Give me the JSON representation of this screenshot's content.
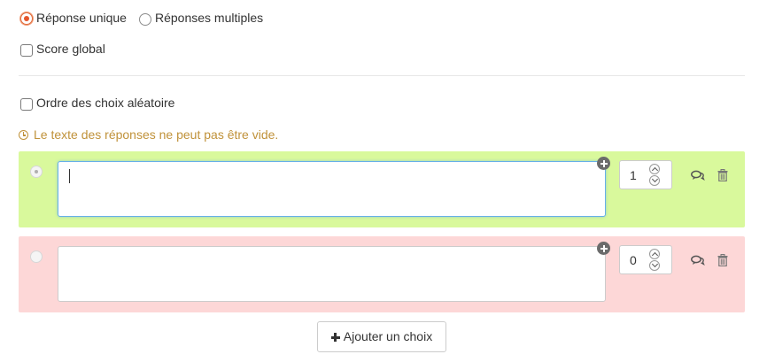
{
  "mode": {
    "single_label": "Réponse unique",
    "multiple_label": "Réponses multiples",
    "selected": "single"
  },
  "global_score": {
    "label": "Score global",
    "checked": false
  },
  "random_order": {
    "label": "Ordre des choix aléatoire",
    "checked": false
  },
  "warning": {
    "text": "Le texte des réponses ne peut pas être vide.",
    "icon": "clock-icon",
    "color": "#c0923a"
  },
  "choices": [
    {
      "text": "",
      "score": "1",
      "status": "correct",
      "color": "#d9f99c",
      "focused": true
    },
    {
      "text": "",
      "score": "0",
      "status": "wrong",
      "color": "#fdd7d7",
      "focused": false
    }
  ],
  "actions": {
    "add_choice_label": "Ajouter un choix",
    "feedback_icon": "comments-icon",
    "delete_icon": "trash-icon",
    "expand_icon": "plus-circle-icon"
  },
  "colors": {
    "accent": "#e5552a",
    "focus": "#66afe9"
  }
}
